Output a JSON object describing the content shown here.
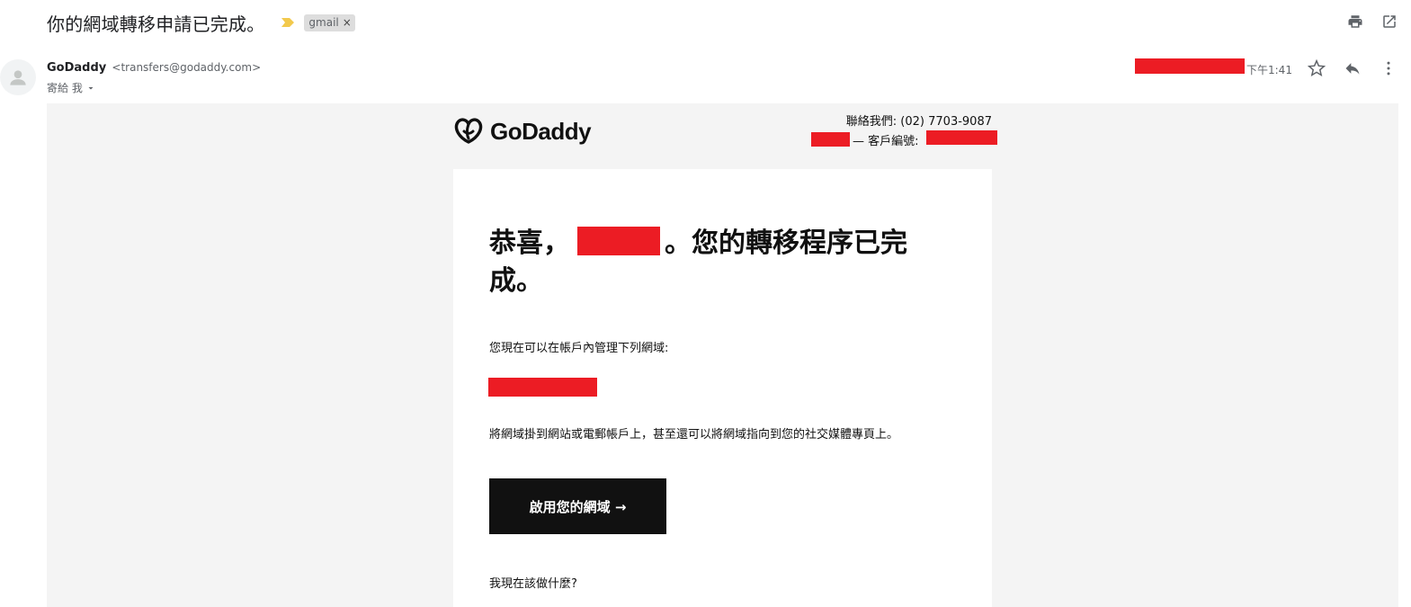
{
  "email": {
    "subject": "你的網域轉移申請已完成。",
    "label": "gmail",
    "label_close": "×",
    "sender_name": "GoDaddy",
    "sender_email": "<transfers@godaddy.com>",
    "to_line": "寄給 我",
    "time": "下午1:41"
  },
  "icons": {
    "print": "print-icon",
    "popout": "open-in-new-window-icon",
    "star": "star-icon",
    "reply": "reply-icon",
    "more": "more-vert-icon"
  },
  "body": {
    "logo_text": "GoDaddy",
    "contact": "聯絡我們:  (02) 7703-9087",
    "account_label": "— 客戶編號:",
    "headline": "恭喜，　　　　。您的轉移程序已完成。",
    "manage_text": "您現在可以在帳戶內管理下列網域:",
    "connect_text": "將網域掛到網站或電郵帳戶上，甚至還可以將網域指向到您的社交媒體專頁上。",
    "cta_label": "啟用您的網域 →",
    "next_text": "我現在該做什麼?"
  },
  "colors": {
    "redaction": "#ec1c24",
    "body_bg": "#f4f4f4",
    "button_bg": "#111111",
    "important_marker": "#f2c94c"
  }
}
